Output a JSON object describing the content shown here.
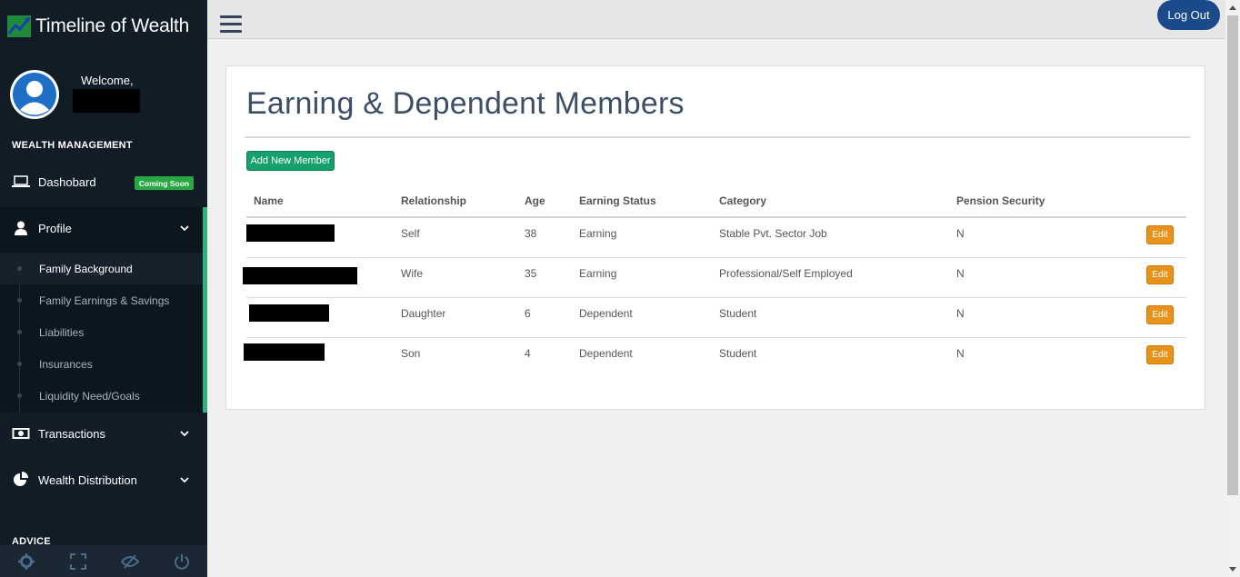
{
  "app": {
    "title": "Timeline of Wealth",
    "colors": {
      "sidebar": "#111c27",
      "accent_green": "#2fb37a",
      "logout_blue": "#1a4a8c",
      "add_green": "#16a06c",
      "edit_orange": "#e8921c",
      "title_blue": "#3c4f66"
    }
  },
  "user": {
    "welcome": "Welcome,"
  },
  "sidebar": {
    "section_wealth": "WEALTH MANAGEMENT",
    "section_advice": "ADVICE",
    "dashboard": {
      "label": "Dashobard",
      "icon": "laptop-icon",
      "badge": "Coming Soon"
    },
    "profile": {
      "label": "Profile",
      "icon": "user-icon"
    },
    "profile_sub": [
      {
        "label": "Family Background",
        "active": true
      },
      {
        "label": "Family Earnings & Savings",
        "active": false
      },
      {
        "label": "Liabilities",
        "active": false
      },
      {
        "label": "Insurances",
        "active": false
      },
      {
        "label": "Liquidity Need/Goals",
        "active": false
      }
    ],
    "transactions": {
      "label": "Transactions",
      "icon": "money-icon"
    },
    "wealth_distribution": {
      "label": "Wealth Distribution",
      "icon": "pie-chart-icon"
    },
    "footer_icons": [
      "gear-icon",
      "fullscreen-icon",
      "eye-slash-icon",
      "power-icon"
    ]
  },
  "topbar": {
    "logout_label": "Log Out"
  },
  "main": {
    "title": "Earning & Dependent Members",
    "add_button": "Add New Member",
    "columns": [
      "Name",
      "Relationship",
      "Age",
      "Earning Status",
      "Category",
      "Pension Security"
    ],
    "edit_label": "Edit",
    "rows": [
      {
        "relationship": "Self",
        "age": "38",
        "earning_status": "Earning",
        "category": "Stable Pvt. Sector Job",
        "pension": "N"
      },
      {
        "relationship": "Wife",
        "age": "35",
        "earning_status": "Earning",
        "category": "Professional/Self Employed",
        "pension": "N"
      },
      {
        "relationship": "Daughter",
        "age": "6",
        "earning_status": "Dependent",
        "category": "Student",
        "pension": "N"
      },
      {
        "relationship": "Son",
        "age": "4",
        "earning_status": "Dependent",
        "category": "Student",
        "pension": "N"
      }
    ]
  }
}
